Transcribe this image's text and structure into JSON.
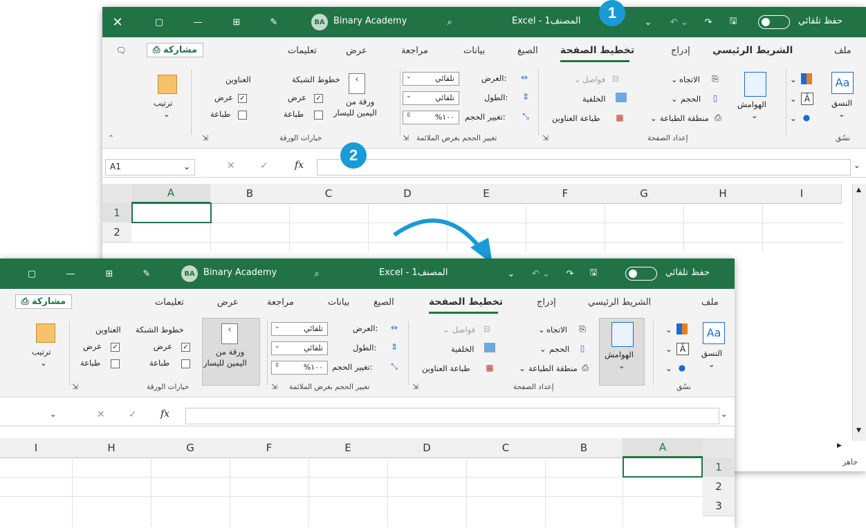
{
  "markers": {
    "step1": "1",
    "step2": "2"
  },
  "colors": {
    "accent": "#217346",
    "marker": "#1a9ad6",
    "ribbon": "#f3f3f3"
  },
  "titlebar": {
    "autosave_label": "حفظ تلقائي",
    "title": "Excel - المصنف1",
    "user_initials": "BA",
    "user_name": "Binary Academy",
    "icons": [
      "close-icon",
      "restore-icon",
      "minimize-icon",
      "ribbon-display-icon",
      "pen-icon",
      "search-icon",
      "customize-icon",
      "undo-icon",
      "redo-icon",
      "save-icon"
    ]
  },
  "tabs": {
    "file": "ملف",
    "home": "الشريط الرئيسي",
    "insert": "إدراج",
    "page_layout": "تخطيط الصفحة",
    "formulas": "الصيغ",
    "data": "بيانات",
    "review": "مراجعة",
    "view": "عرض",
    "help": "تعليمات",
    "share": "مشاركة"
  },
  "ribbon": {
    "themes": "النسق",
    "themes_group": "نسُق",
    "margins": "الهوامش",
    "orientation": "الاتجاه",
    "size": "الحجم",
    "print_area": "منطقة الطباعة",
    "breaks": "فواصل",
    "background": "الخلفية",
    "print_titles": "طباعة العناوين",
    "page_setup_group": "إعداد الصفحة",
    "width_label": "العرض:",
    "width_value": "تلقائي",
    "height_label": "الطول:",
    "height_value": "تلقائي",
    "scale_label": "تغيير الحجم:",
    "scale_value": "%١٠٠",
    "scale_group": "تغيير الحجم بغرض الملائمة",
    "sheet_rtl_line1": "ورقة من",
    "sheet_rtl_line2": "اليمين لليسار",
    "gridlines": "خطوط الشبكة",
    "headings": "العناوين",
    "view_check": "عرض",
    "print_check": "طباعة",
    "sheet_options_group": "خيارات الورقة",
    "arrange": "ترتيب"
  },
  "formula": {
    "name_box": "A1",
    "fx": "fx"
  },
  "columns": [
    "A",
    "B",
    "C",
    "D",
    "E",
    "F",
    "G",
    "H",
    "I"
  ],
  "rows_top": [
    "1",
    "2"
  ],
  "rows_bottom": [
    "1",
    "2",
    "3"
  ],
  "status": {
    "ready": "جاهز"
  }
}
